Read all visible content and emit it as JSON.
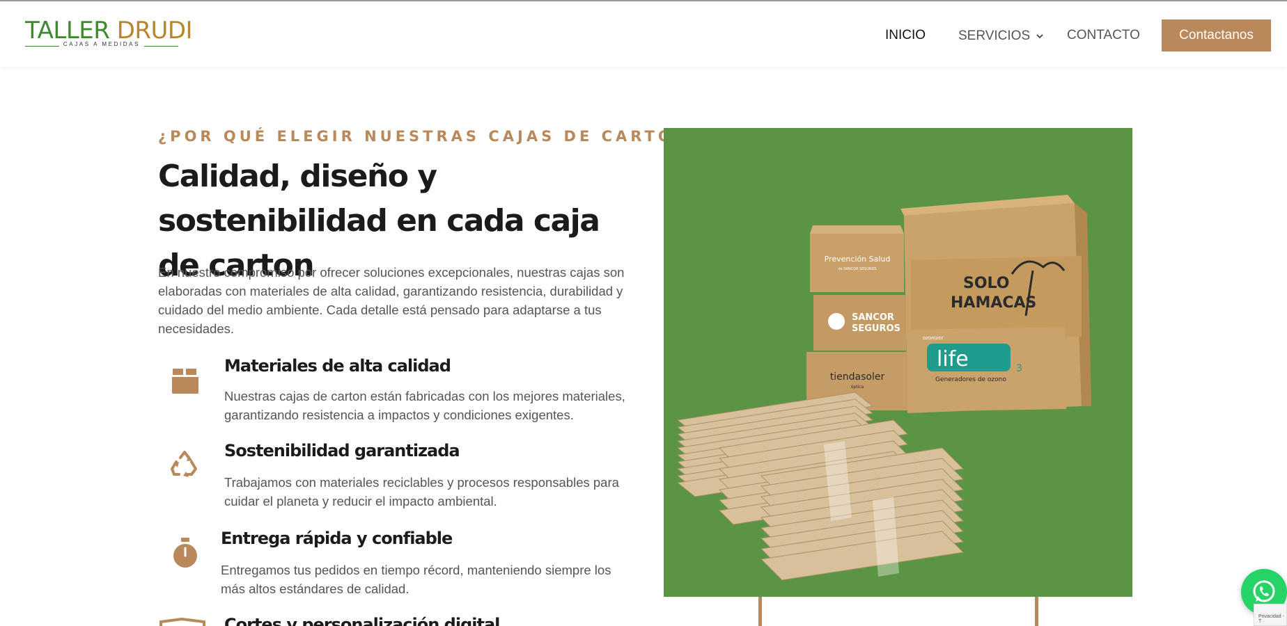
{
  "header": {
    "logo": {
      "title_part1": "TALLER ",
      "title_part2": "DRUDI",
      "subtitle": "CAJAS A MEDIDAS"
    },
    "nav": {
      "inicio": "INICIO",
      "servicios": "SERVICIOS",
      "contacto": "CONTACTO"
    },
    "cta_label": "Contactanos"
  },
  "main": {
    "eyebrow": "¿POR QUÉ ELEGIR NUESTRAS CAJAS DE CARTON?",
    "headline": "Calidad, diseño y sostenibilidad en cada caja de carton",
    "intro": "En nuestro compromiso por ofrecer soluciones excepcionales, nuestras cajas son elaboradas con materiales de alta calidad, garantizando resistencia, durabilidad y cuidado del medio ambiente. Cada detalle está pensado para adaptarse a tus necesidades.",
    "features": [
      {
        "title": "Materiales de alta calidad",
        "text": "Nuestras cajas de carton están fabricadas con los mejores materiales, garantizando resistencia a impactos y condiciones exigentes.",
        "icon": "box-icon"
      },
      {
        "title": "Sostenibilidad garantizada",
        "text": "Trabajamos con materiales reciclables y procesos responsables para cuidar el planeta y reducir el impacto ambiental.",
        "icon": "recycle-icon"
      },
      {
        "title": "Entrega rápida y confiable",
        "text": "Entregamos tus pedidos en tiempo récord, manteniendo siempre los más altos estándares de calidad.",
        "icon": "stopwatch-icon"
      },
      {
        "title": "Cortes y personalización digital",
        "text": "",
        "icon": "boxes-icon"
      }
    ]
  },
  "hero_image": {
    "box_labels": [
      "Prevención Salud",
      "de SANCOR SEGUROS",
      "SANCOR",
      "SEGUROS",
      "SOLO",
      "HAMACAS",
      "tiendasoler",
      "óptica",
      "ozonizer",
      "life",
      "O",
      "3",
      "Generadores de ozono"
    ]
  },
  "widgets": {
    "recaptcha_text": "Privacidad - T"
  },
  "colors": {
    "accent": "#b9895c",
    "green": "#5b9444",
    "logo_green": "#3f8a2e",
    "logo_gold": "#b8862e",
    "whatsapp": "#25d366"
  }
}
